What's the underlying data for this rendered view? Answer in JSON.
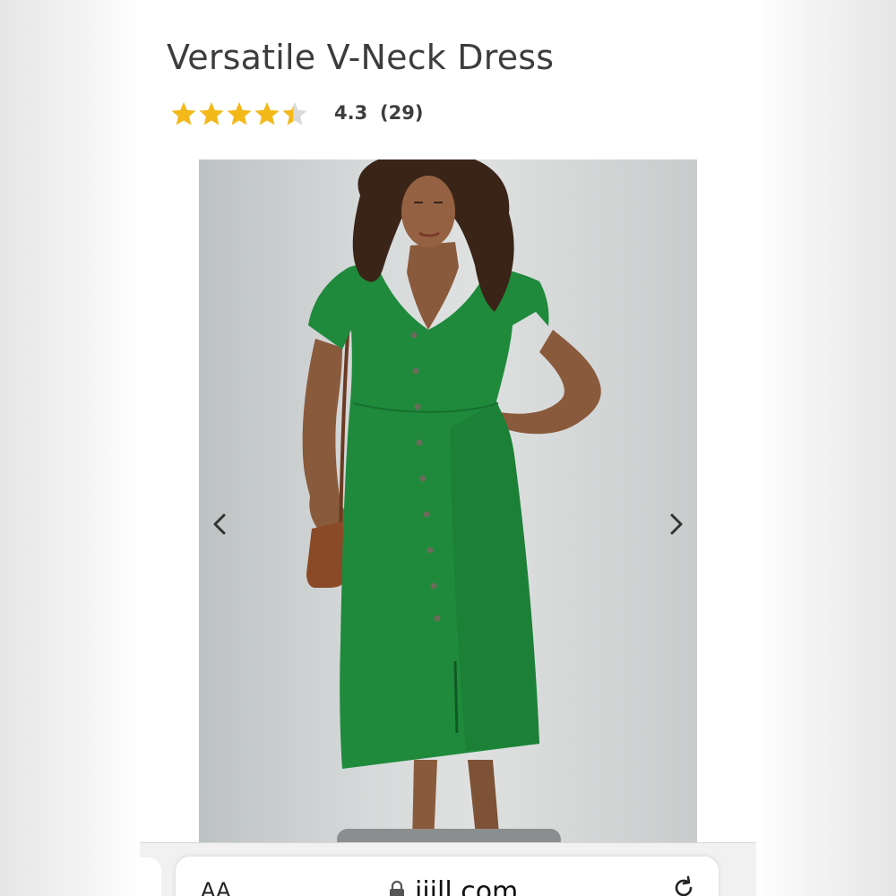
{
  "product": {
    "title": "Versatile V-Neck Dress",
    "rating": 4.3,
    "rating_text": "4.3",
    "review_count_text": "(29)",
    "star_color": "#f3b81a",
    "star_empty_color": "#d9d9d9"
  },
  "gallery": {
    "image_subject": "model wearing green button-front midi dress with brown crossbody bag",
    "dress_color": "#1f8a3c",
    "prev_icon": "chevron-left-icon",
    "next_icon": "chevron-right-icon"
  },
  "browser": {
    "aa_label": "AA",
    "lock_icon": "lock-icon",
    "url": "jjill.com",
    "reload_icon": "reload-icon"
  }
}
